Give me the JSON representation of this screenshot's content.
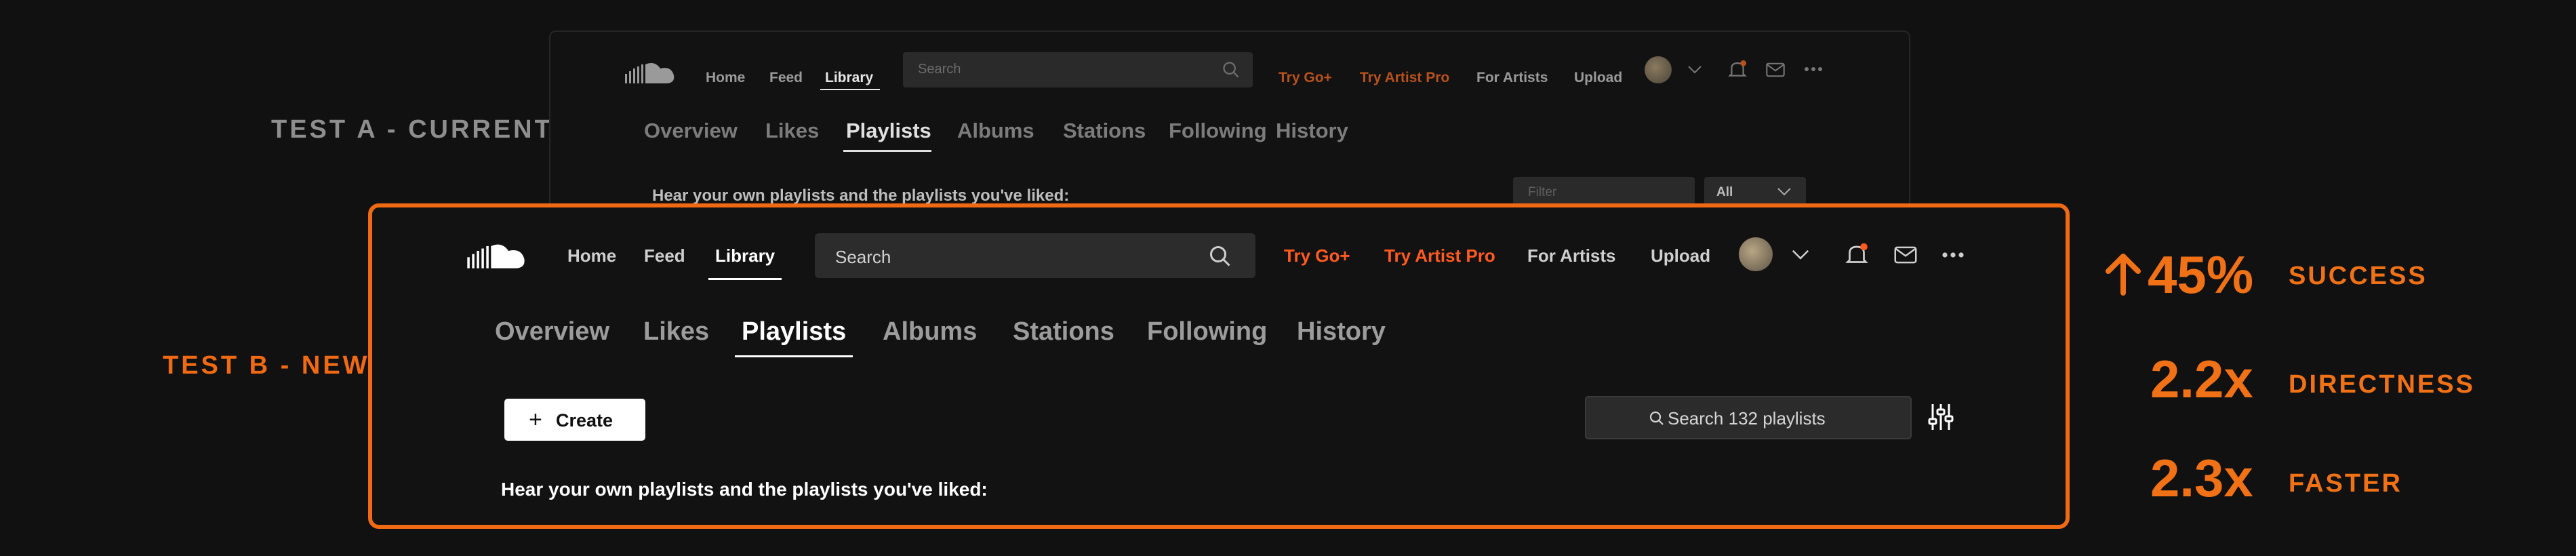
{
  "test_a": {
    "label": "TEST A - CURRENT",
    "nav": [
      "Home",
      "Feed",
      "Library"
    ],
    "search_placeholder": "Search",
    "links": [
      "Try Go+",
      "Try Artist Pro",
      "For Artists",
      "Upload"
    ],
    "tabs": [
      "Overview",
      "Likes",
      "Playlists",
      "Albums",
      "Stations",
      "Following",
      "History"
    ],
    "active_tab": "Playlists",
    "caption": "Hear your own playlists and the playlists you've liked:",
    "filter_placeholder": "Filter",
    "filter_option": "All"
  },
  "test_b": {
    "label": "TEST B - NEW",
    "nav": [
      "Home",
      "Feed",
      "Library"
    ],
    "search_placeholder": "Search",
    "links": [
      "Try Go+",
      "Try Artist Pro",
      "For Artists",
      "Upload"
    ],
    "tabs": [
      "Overview",
      "Likes",
      "Playlists",
      "Albums",
      "Stations",
      "Following",
      "History"
    ],
    "active_tab": "Playlists",
    "create_label": "Create",
    "search_playlists": "Search 132 playlists",
    "caption": "Hear your own playlists and the playlists you've liked:"
  },
  "stats": [
    {
      "value": "45%",
      "label": "SUCCESS",
      "arrow": "up-arrow-icon"
    },
    {
      "value": "2.2x",
      "label": "DIRECTNESS"
    },
    {
      "value": "2.3x",
      "label": "FASTER"
    }
  ],
  "colors": {
    "accent": "#f06a13",
    "background": "#111111",
    "link_orange": "#ff5500"
  },
  "icons": [
    "soundcloud-logo",
    "search-icon",
    "avatar",
    "chevron-down-icon",
    "bell-icon",
    "mail-icon",
    "more-icon",
    "plus-icon",
    "filter-sliders-icon"
  ]
}
